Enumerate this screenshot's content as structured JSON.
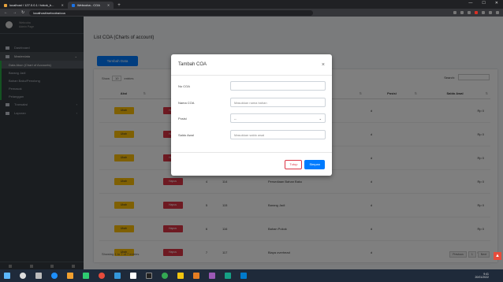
{
  "browser": {
    "tabs": [
      {
        "label": "localhost / 127.0.0.1 / tokok_b...",
        "active": false,
        "color": "#e8a33d"
      },
      {
        "label": "Webcoba - COA",
        "active": true,
        "color": "#1a73e8"
      }
    ],
    "url": "localhost/webcoba/coa"
  },
  "sidebar": {
    "brand_line1": "Webcoba",
    "brand_line2": "Admin Page",
    "items": [
      {
        "label": "Dashboard",
        "icon": "dashboard-icon"
      },
      {
        "label": "Masterdata",
        "icon": "database-icon",
        "expanded": true
      }
    ],
    "subitems": [
      {
        "label": "Data Akun (Chart of Accounts)",
        "selected": true
      },
      {
        "label": "Barang Jadi"
      },
      {
        "label": "Bahan Baku/Penolong"
      },
      {
        "label": "Pemasok"
      },
      {
        "label": "Pelanggan"
      }
    ],
    "items_after": [
      {
        "label": "Transaksi",
        "icon": "exchange-icon"
      },
      {
        "label": "Laporan",
        "icon": "report-icon"
      }
    ]
  },
  "main": {
    "title": "List COA (Charts of account)",
    "add_button": "Tambah Data",
    "show_label": "Show",
    "show_value": "10",
    "entries_label": "entries",
    "search_label": "Search:",
    "columns": [
      "Aksi",
      "",
      "No",
      "Kode",
      "Nama COA",
      "Posisi",
      "Saldo Awal"
    ],
    "action_labels": {
      "edit": "Ubah",
      "delete": "Hapus"
    },
    "rows": [
      {
        "no": "1",
        "kode": "111",
        "nama": "Kas",
        "posisi": "d",
        "saldo": "Rp 0"
      },
      {
        "no": "2",
        "kode": "112",
        "nama": "Piutang",
        "posisi": "d",
        "saldo": "Rp 0"
      },
      {
        "no": "3",
        "kode": "113",
        "nama": "Persediaan",
        "posisi": "d",
        "saldo": "Rp 0"
      },
      {
        "no": "4",
        "kode": "114",
        "nama": "Persediaan Bahan Baku",
        "posisi": "d",
        "saldo": "Rp 0"
      },
      {
        "no": "5",
        "kode": "115",
        "nama": "Barang Jadi",
        "posisi": "d",
        "saldo": "Rp 0"
      },
      {
        "no": "6",
        "kode": "116",
        "nama": "Bahan Pokok",
        "posisi": "d",
        "saldo": "Rp 0"
      },
      {
        "no": "7",
        "kode": "117",
        "nama": "Biaya overhead",
        "posisi": "d",
        "saldo": "Rp 0"
      }
    ],
    "showing": "Showing 1 to 7 of 7 entries",
    "pager": [
      "Previous",
      "1",
      "Next"
    ]
  },
  "modal": {
    "title": "Tambah COA",
    "close": "×",
    "fields": [
      {
        "label": "No COA",
        "placeholder": ""
      },
      {
        "label": "Nama COA",
        "placeholder": "Masukkan nama bahan"
      },
      {
        "label": "Posisi",
        "value": "--",
        "select": true
      },
      {
        "label": "Saldo Awal",
        "placeholder": "Masukkan saldo awal"
      }
    ],
    "btn_close": "Tutup",
    "btn_save": "Simpan"
  },
  "taskbar": {
    "time": "9:41",
    "date": "20/01/2022"
  },
  "colors": {
    "primary": "#007bff",
    "warning": "#ffc107",
    "danger": "#dc3545",
    "sidebar": "#343a40"
  }
}
